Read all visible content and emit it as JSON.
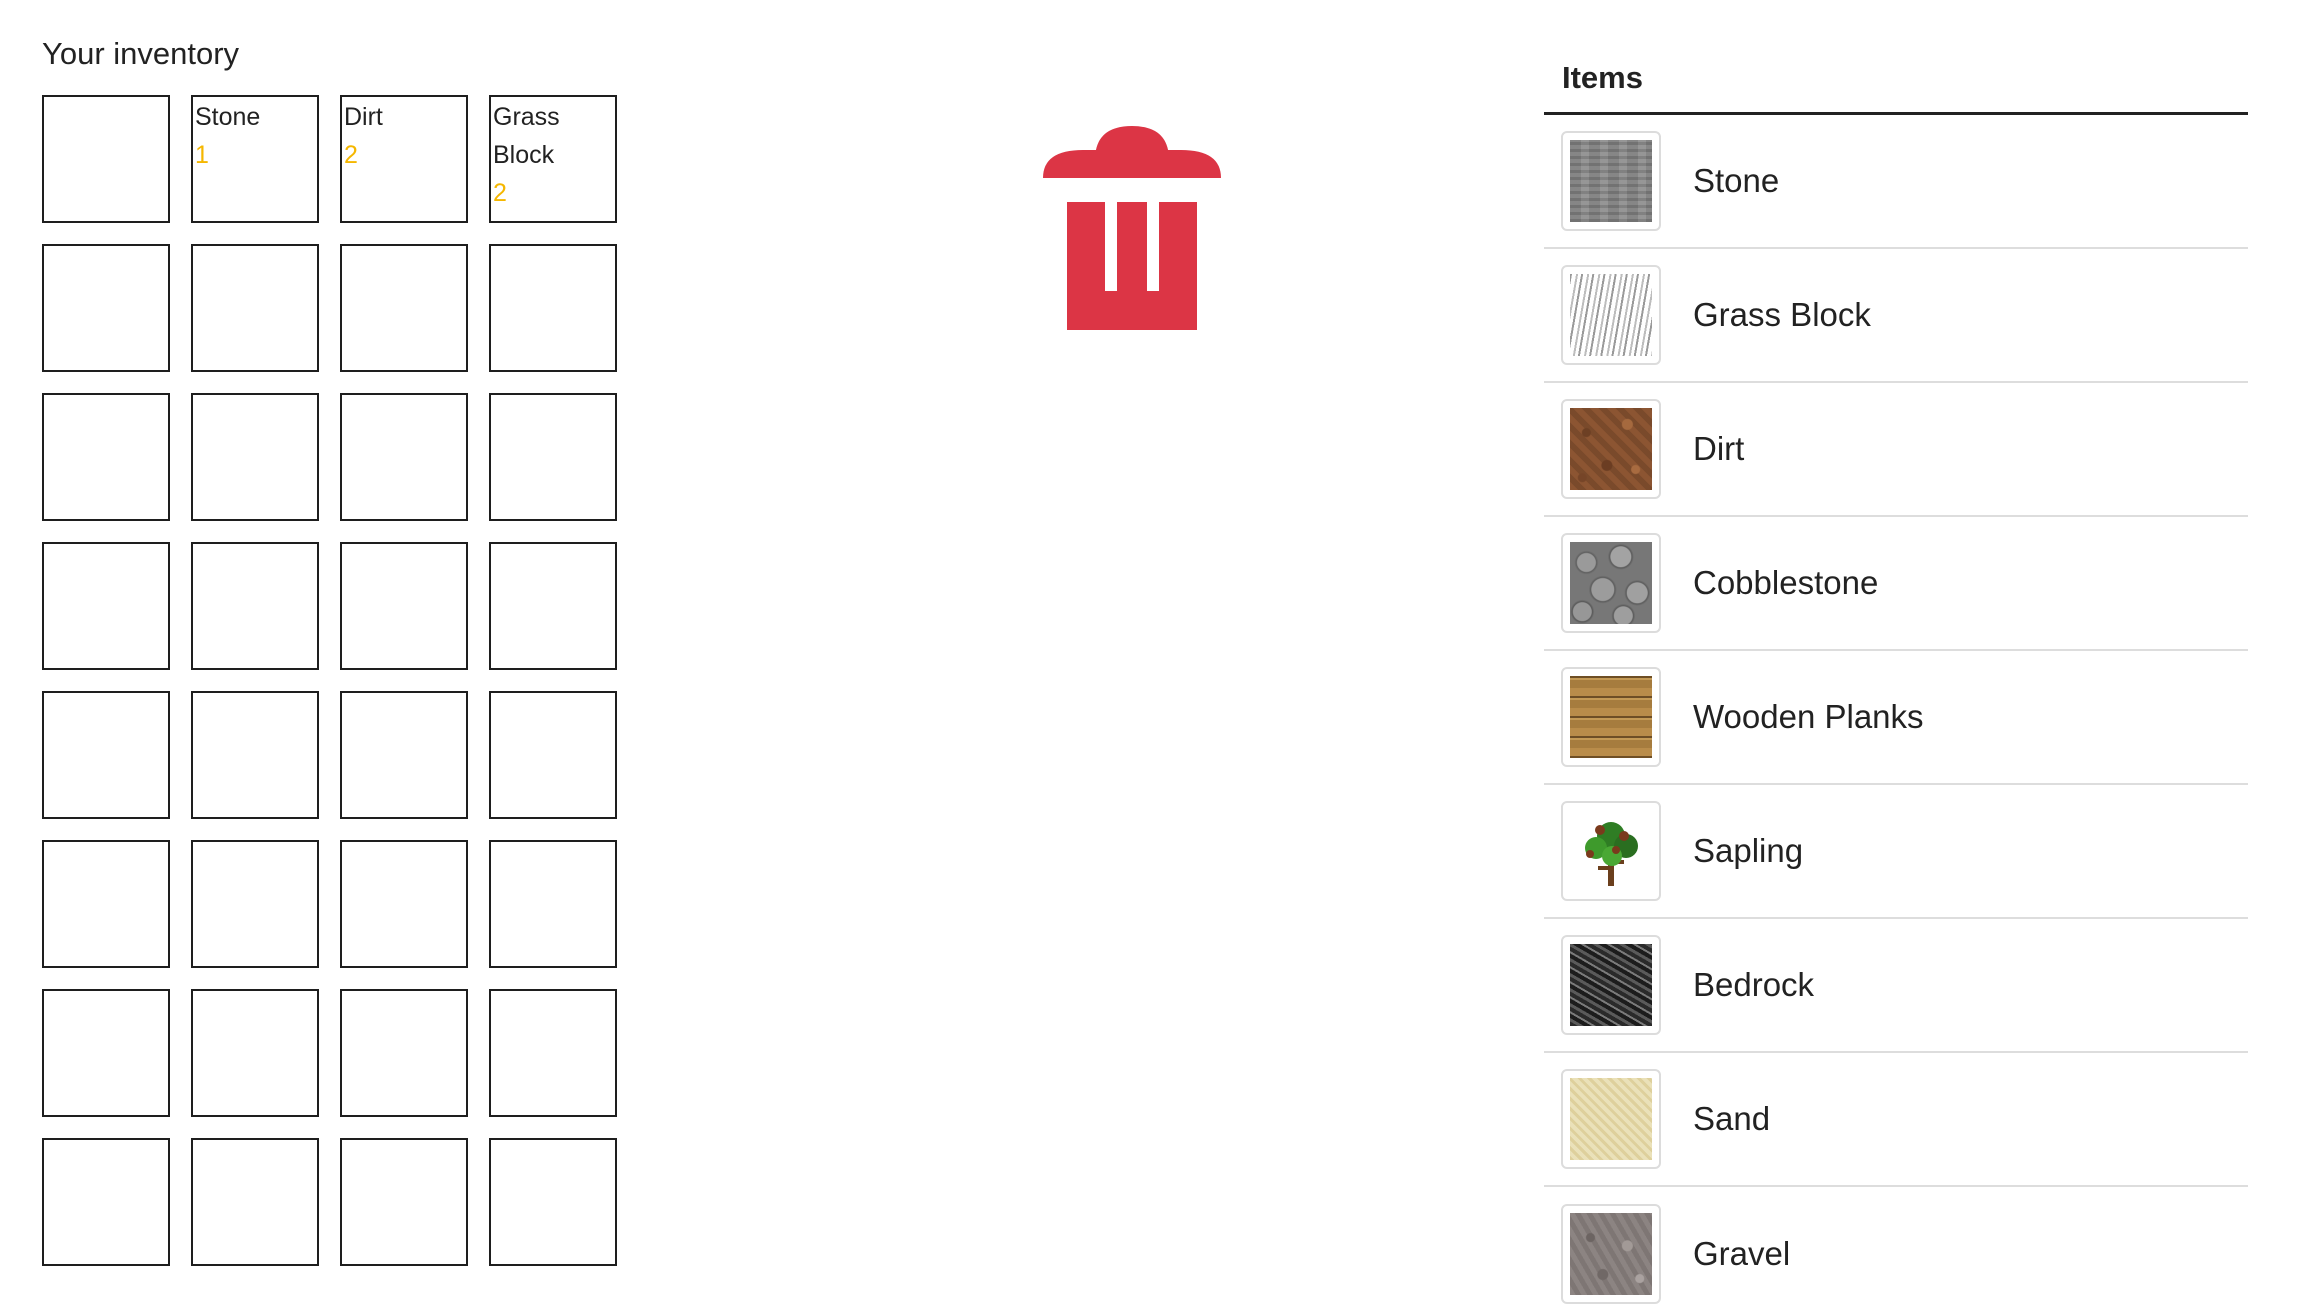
{
  "inventory": {
    "title": "Your inventory",
    "slots": [
      {
        "name": "",
        "count": ""
      },
      {
        "name": "Stone",
        "count": "1"
      },
      {
        "name": "Dirt",
        "count": "2"
      },
      {
        "name": "Grass Block",
        "count": "2"
      },
      {
        "name": "",
        "count": ""
      },
      {
        "name": "",
        "count": ""
      },
      {
        "name": "",
        "count": ""
      },
      {
        "name": "",
        "count": ""
      },
      {
        "name": "",
        "count": ""
      },
      {
        "name": "",
        "count": ""
      },
      {
        "name": "",
        "count": ""
      },
      {
        "name": "",
        "count": ""
      },
      {
        "name": "",
        "count": ""
      },
      {
        "name": "",
        "count": ""
      },
      {
        "name": "",
        "count": ""
      },
      {
        "name": "",
        "count": ""
      },
      {
        "name": "",
        "count": ""
      },
      {
        "name": "",
        "count": ""
      },
      {
        "name": "",
        "count": ""
      },
      {
        "name": "",
        "count": ""
      },
      {
        "name": "",
        "count": ""
      },
      {
        "name": "",
        "count": ""
      },
      {
        "name": "",
        "count": ""
      },
      {
        "name": "",
        "count": ""
      },
      {
        "name": "",
        "count": ""
      },
      {
        "name": "",
        "count": ""
      },
      {
        "name": "",
        "count": ""
      },
      {
        "name": "",
        "count": ""
      },
      {
        "name": "",
        "count": ""
      },
      {
        "name": "",
        "count": ""
      },
      {
        "name": "",
        "count": ""
      },
      {
        "name": "",
        "count": ""
      }
    ],
    "count_color": "#f5b700"
  },
  "trash": {
    "icon": "trash-icon",
    "color": "#dc3545"
  },
  "items": {
    "header": "Items",
    "list": [
      {
        "label": "Stone",
        "icon": "stone-texture-icon"
      },
      {
        "label": "Grass Block",
        "icon": "grass-block-texture-icon"
      },
      {
        "label": "Dirt",
        "icon": "dirt-texture-icon"
      },
      {
        "label": "Cobblestone",
        "icon": "cobblestone-texture-icon"
      },
      {
        "label": "Wooden Planks",
        "icon": "wooden-planks-texture-icon"
      },
      {
        "label": "Sapling",
        "icon": "sapling-icon"
      },
      {
        "label": "Bedrock",
        "icon": "bedrock-texture-icon"
      },
      {
        "label": "Sand",
        "icon": "sand-texture-icon"
      },
      {
        "label": "Gravel",
        "icon": "gravel-texture-icon"
      }
    ]
  }
}
